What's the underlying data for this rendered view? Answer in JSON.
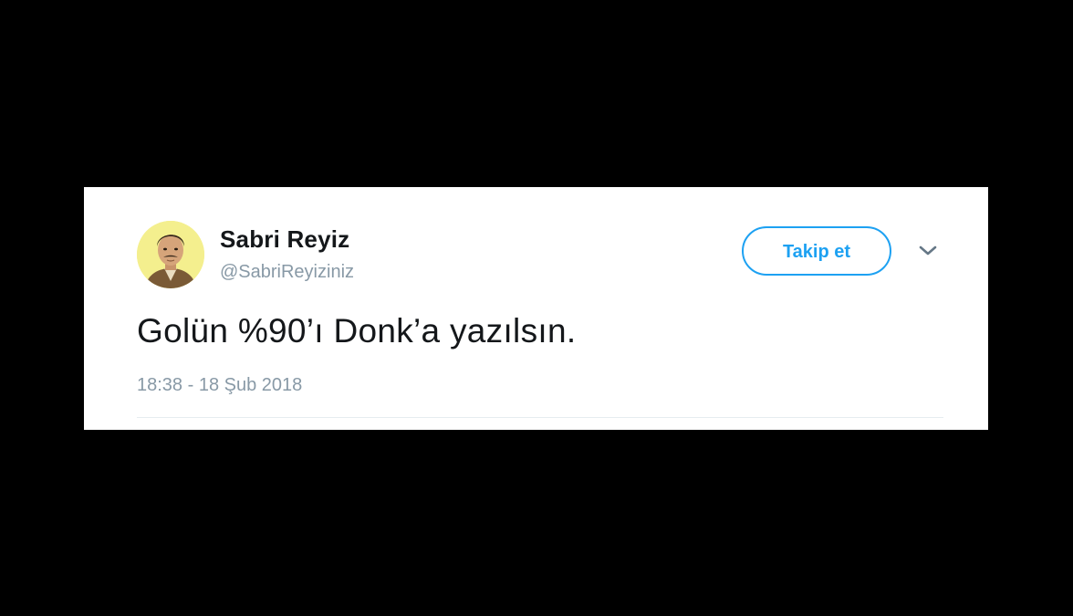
{
  "tweet": {
    "display_name": "Sabri Reyiz",
    "handle": "@SabriReyiziniz",
    "follow_label": "Takip et",
    "text": "Golün %90’ı Donk’a yazılsın.",
    "timestamp": "18:38 - 18 Şub 2018",
    "avatar": "profile-avatar",
    "menu_icon": "chevron-down-icon"
  },
  "colors": {
    "background": "#000000",
    "card": "#ffffff",
    "accent": "#1da1f2",
    "primary_text": "#14171a",
    "secondary_text": "#8899a6"
  }
}
